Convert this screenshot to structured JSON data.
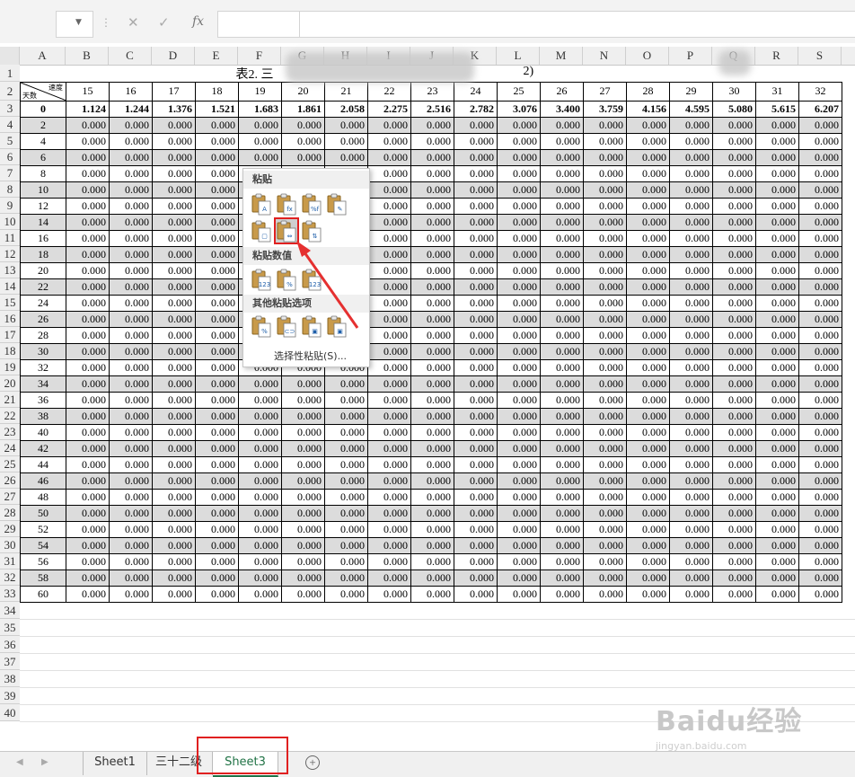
{
  "formula_bar": {
    "function_label": "fx"
  },
  "columns": [
    "A",
    "B",
    "C",
    "D",
    "E",
    "F",
    "G",
    "H",
    "I",
    "J",
    "K",
    "L",
    "M",
    "N",
    "O",
    "P",
    "Q",
    "R",
    "S"
  ],
  "row_numbers": [
    "1",
    "2",
    "3",
    "4",
    "5",
    "6",
    "7",
    "8",
    "9",
    "10",
    "11",
    "12",
    "13",
    "14",
    "15",
    "16",
    "17",
    "18",
    "19",
    "20",
    "21",
    "22",
    "23",
    "24",
    "25",
    "26",
    "27",
    "28",
    "29",
    "30",
    "31",
    "32",
    "33",
    "34",
    "35",
    "36",
    "37",
    "38",
    "39",
    "40"
  ],
  "sheet": {
    "title": "表2. 三",
    "title_tail": "2)",
    "corner_top": "速度",
    "corner_bottom": "天数",
    "speeds": [
      "15",
      "16",
      "17",
      "18",
      "19",
      "20",
      "21",
      "22",
      "23",
      "24",
      "25",
      "26",
      "27",
      "28",
      "29",
      "30",
      "31",
      "32"
    ],
    "first_row": {
      "day": "0",
      "values": [
        "1.124",
        "1.244",
        "1.376",
        "1.521",
        "1.683",
        "1.861",
        "2.058",
        "2.275",
        "2.516",
        "2.782",
        "3.076",
        "3.400",
        "3.759",
        "4.156",
        "4.595",
        "5.080",
        "5.615",
        "6.207"
      ]
    },
    "days": [
      "2",
      "4",
      "6",
      "8",
      "10",
      "12",
      "14",
      "16",
      "18",
      "20",
      "22",
      "24",
      "26",
      "28",
      "30",
      "32",
      "34",
      "36",
      "38",
      "40",
      "42",
      "44",
      "46",
      "48",
      "50",
      "52",
      "54",
      "56",
      "58",
      "60"
    ],
    "zero_value": "0.000"
  },
  "paste_menu": {
    "section_paste": "粘贴",
    "section_values": "粘贴数值",
    "section_other": "其他粘贴选项",
    "special": "选择性粘贴(S)...",
    "icons": [
      "paste-icon",
      "paste-formulas-icon",
      "paste-formulas-number-format-icon",
      "paste-keep-source-formatting-icon",
      "paste-no-borders-icon",
      "paste-keep-column-widths-icon",
      "paste-transpose-icon",
      "paste-values-icon",
      "paste-values-number-format-icon",
      "paste-values-source-formatting-icon",
      "paste-formatting-icon",
      "paste-link-icon",
      "paste-picture-icon",
      "paste-linked-picture-icon"
    ]
  },
  "tabs": [
    "Sheet1",
    "三十二级",
    "Sheet3"
  ],
  "active_tab": "Sheet3",
  "watermark": {
    "brand": "Baidu经验",
    "url": "jingyan.baidu.com"
  },
  "colors": {
    "excel_green": "#217346",
    "highlight_red": "#e02020"
  }
}
